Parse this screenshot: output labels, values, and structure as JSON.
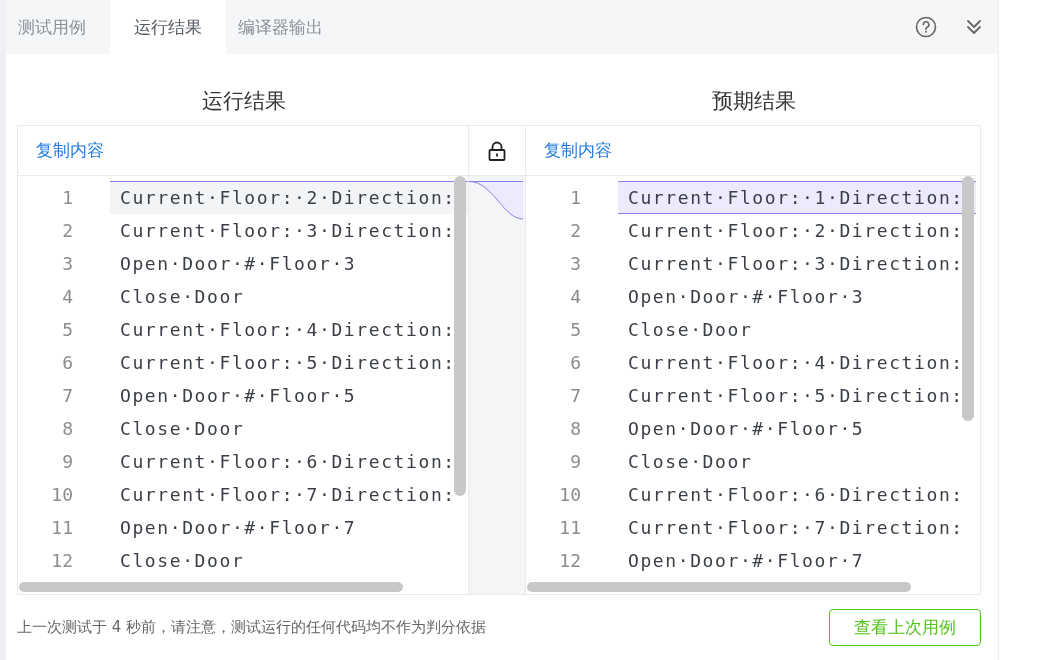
{
  "tabs": [
    {
      "label": "测试用例",
      "selected": false
    },
    {
      "label": "运行结果",
      "selected": true
    },
    {
      "label": "编译器输出",
      "selected": false
    }
  ],
  "panes": [
    {
      "title": "运行结果",
      "copy_label": "复制内容",
      "lines": [
        {
          "number": "1",
          "text": "Current·Floor:·2·Direction:",
          "current": true,
          "changed": false
        },
        {
          "number": "2",
          "text": "Current·Floor:·3·Direction:",
          "current": false,
          "changed": false
        },
        {
          "number": "3",
          "text": "Open·Door·#·Floor·3",
          "current": false,
          "changed": false
        },
        {
          "number": "4",
          "text": "Close·Door",
          "current": false,
          "changed": false
        },
        {
          "number": "5",
          "text": "Current·Floor:·4·Direction:",
          "current": false,
          "changed": false
        },
        {
          "number": "6",
          "text": "Current·Floor:·5·Direction:",
          "current": false,
          "changed": false
        },
        {
          "number": "7",
          "text": "Open·Door·#·Floor·5",
          "current": false,
          "changed": false
        },
        {
          "number": "8",
          "text": "Close·Door",
          "current": false,
          "changed": false
        },
        {
          "number": "9",
          "text": "Current·Floor:·6·Direction:",
          "current": false,
          "changed": false
        },
        {
          "number": "10",
          "text": "Current·Floor:·7·Direction:",
          "current": false,
          "changed": false
        },
        {
          "number": "11",
          "text": "Open·Door·#·Floor·7",
          "current": false,
          "changed": false
        },
        {
          "number": "12",
          "text": "Close·Door",
          "current": false,
          "changed": false
        }
      ]
    },
    {
      "title": "预期结果",
      "copy_label": "复制内容",
      "lines": [
        {
          "number": "1",
          "text": "Current·Floor:·1·Direction:",
          "current": false,
          "changed": true
        },
        {
          "number": "2",
          "text": "Current·Floor:·2·Direction:",
          "current": false,
          "changed": false
        },
        {
          "number": "3",
          "text": "Current·Floor:·3·Direction:",
          "current": false,
          "changed": false
        },
        {
          "number": "4",
          "text": "Open·Door·#·Floor·3",
          "current": false,
          "changed": false
        },
        {
          "number": "5",
          "text": "Close·Door",
          "current": false,
          "changed": false
        },
        {
          "number": "6",
          "text": "Current·Floor:·4·Direction:",
          "current": false,
          "changed": false
        },
        {
          "number": "7",
          "text": "Current·Floor:·5·Direction:",
          "current": false,
          "changed": false
        },
        {
          "number": "8",
          "text": "Open·Door·#·Floor·5",
          "current": false,
          "changed": false
        },
        {
          "number": "9",
          "text": "Close·Door",
          "current": false,
          "changed": false
        },
        {
          "number": "10",
          "text": "Current·Floor:·6·Direction:",
          "current": false,
          "changed": false
        },
        {
          "number": "11",
          "text": "Current·Floor:·7·Direction:",
          "current": false,
          "changed": false
        },
        {
          "number": "12",
          "text": "Open·Door·#·Floor·7",
          "current": false,
          "changed": false
        }
      ]
    }
  ],
  "footer": {
    "note": "上一次测试于 4 秒前，请注意，测试运行的任何代码均不作为判分依据",
    "button": "查看上次用例"
  }
}
